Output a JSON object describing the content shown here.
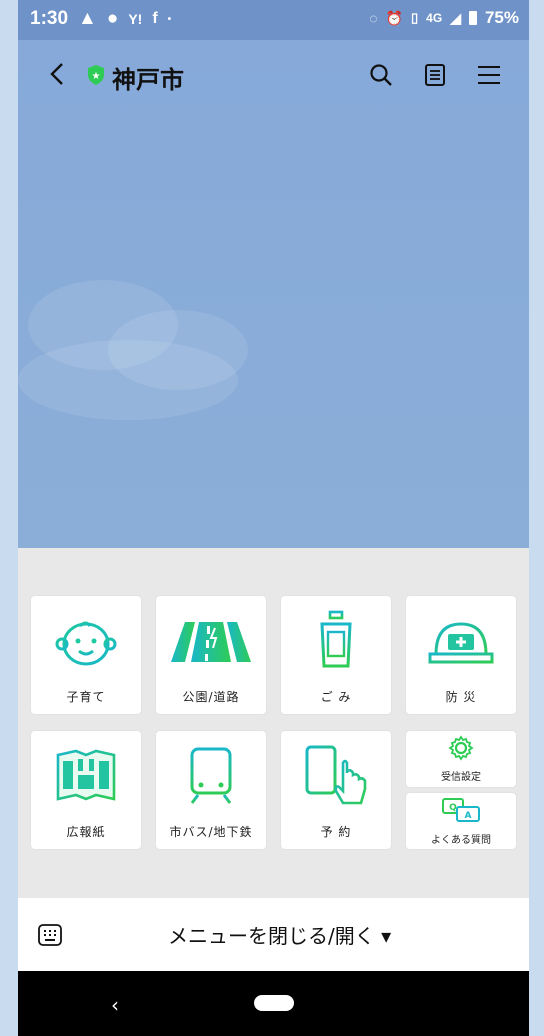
{
  "status_bar": {
    "time": "1:30",
    "battery": "75%",
    "network": "4G"
  },
  "app_bar": {
    "title": "神戸市"
  },
  "menu": {
    "row1": [
      {
        "label": "子育て",
        "icon": "baby-face-icon"
      },
      {
        "label": "公園/道路",
        "icon": "road-icon"
      },
      {
        "label": "ご み",
        "icon": "trash-can-icon"
      },
      {
        "label": "防 災",
        "icon": "helmet-icon"
      }
    ],
    "row2": [
      {
        "label": "広報紙",
        "icon": "newspaper-icon"
      },
      {
        "label": "市バス/地下鉄",
        "icon": "train-icon"
      },
      {
        "label": "予 約",
        "icon": "phone-tap-icon"
      }
    ],
    "small": [
      {
        "label": "受信設定",
        "icon": "gear-icon"
      },
      {
        "label": "よくある質問",
        "icon": "qa-icon"
      }
    ]
  },
  "bottom_bar": {
    "label": "メニューを閉じる/開く ▾"
  },
  "colors": {
    "accent_green": "#22c55e",
    "accent_cyan": "#19b7c9",
    "chat_bg": "#89acd8"
  }
}
